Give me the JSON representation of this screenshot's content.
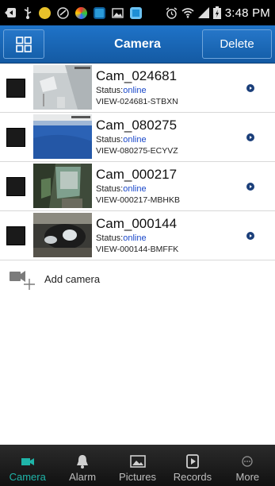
{
  "statusbar": {
    "clock": "3:48 PM",
    "icons": [
      "back-icon",
      "usb-icon",
      "app-icon",
      "app-icon",
      "app-icon",
      "app-icon",
      "gallery-icon",
      "app-icon",
      "alarm-clock-icon",
      "wifi-icon",
      "signal-icon",
      "battery-icon"
    ]
  },
  "header": {
    "title": "Camera",
    "delete_label": "Delete"
  },
  "cameras": [
    {
      "name": "Cam_024681",
      "status_label": "Status:",
      "status_value": "online",
      "view_id": "VIEW-024681-STBXN"
    },
    {
      "name": "Cam_080275",
      "status_label": "Status:",
      "status_value": "online",
      "view_id": "VIEW-080275-ECYVZ"
    },
    {
      "name": "Cam_000217",
      "status_label": "Status:",
      "status_value": "online",
      "view_id": "VIEW-000217-MBHKB"
    },
    {
      "name": "Cam_000144",
      "status_label": "Status:",
      "status_value": "online",
      "view_id": "VIEW-000144-BMFFK"
    }
  ],
  "add_camera": {
    "label": "Add camera"
  },
  "tabs": [
    {
      "label": "Camera",
      "icon": "camera-icon",
      "active": true
    },
    {
      "label": "Alarm",
      "icon": "bell-icon",
      "active": false
    },
    {
      "label": "Pictures",
      "icon": "picture-icon",
      "active": false
    },
    {
      "label": "Records",
      "icon": "record-icon",
      "active": false
    },
    {
      "label": "More",
      "icon": "more-icon",
      "active": false
    }
  ],
  "colors": {
    "header": "#1a68b8",
    "status_online": "#1a48c9",
    "tab_active": "#1fb4a8"
  }
}
